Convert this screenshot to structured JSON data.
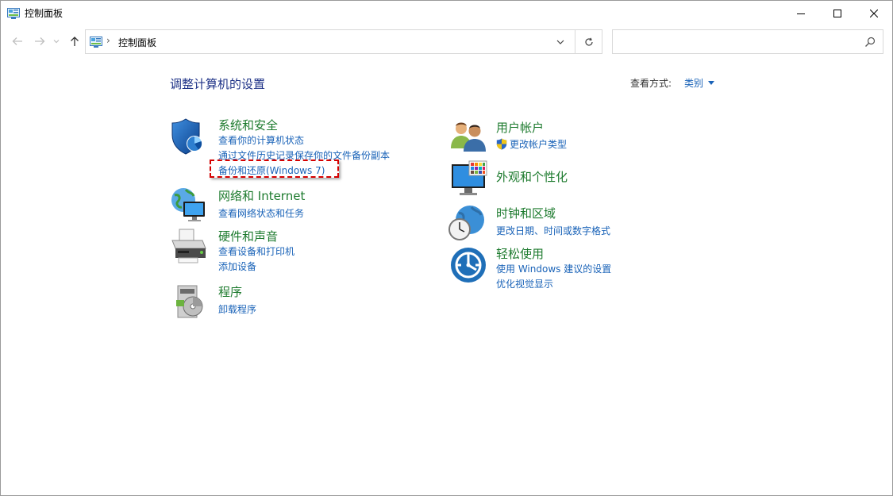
{
  "window": {
    "title": "控制面板"
  },
  "address": {
    "path": "控制面板",
    "separator": "›"
  },
  "search": {
    "placeholder": ""
  },
  "header": {
    "heading": "调整计算机的设置",
    "view_by_label": "查看方式:",
    "view_by_value": "类别"
  },
  "categories": [
    {
      "title": "系统和安全",
      "icon": "shield-icon",
      "links": [
        "查看你的计算机状态",
        "通过文件历史记录保存你的文件备份副本",
        "备份和还原(Windows 7)"
      ]
    },
    {
      "title": "网络和 Internet",
      "icon": "network-globe-icon",
      "links": [
        "查看网络状态和任务"
      ]
    },
    {
      "title": "硬件和声音",
      "icon": "printer-icon",
      "links": [
        "查看设备和打印机",
        "添加设备"
      ]
    },
    {
      "title": "程序",
      "icon": "programs-disc-icon",
      "links": [
        "卸载程序"
      ]
    },
    {
      "title": "用户帐户",
      "icon": "users-icon",
      "links": [
        "更改帐户类型"
      ]
    },
    {
      "title": "外观和个性化",
      "icon": "monitor-palette-icon",
      "links": []
    },
    {
      "title": "时钟和区域",
      "icon": "clock-globe-icon",
      "links": [
        "更改日期、时间或数字格式"
      ]
    },
    {
      "title": "轻松使用",
      "icon": "ease-of-access-icon",
      "links": [
        "使用 Windows 建议的设置",
        "优化视觉显示"
      ]
    }
  ],
  "colors": {
    "heading": "#1e3287",
    "category_title": "#1c7a2d",
    "link": "#1a63b8",
    "highlight_border": "#d60000"
  }
}
